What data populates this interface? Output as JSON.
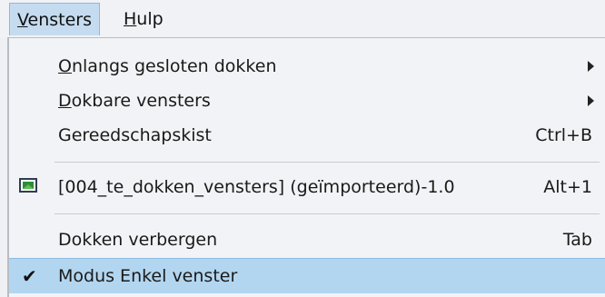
{
  "menubar": {
    "items": [
      {
        "accel": "V",
        "rest": "ensters"
      },
      {
        "accel": "H",
        "rest": "ulp"
      }
    ]
  },
  "menu": {
    "items": [
      {
        "accel": "O",
        "rest": "nlangs gesloten dokken",
        "submenu": true
      },
      {
        "accel": "D",
        "rest": "okbare vensters",
        "submenu": true
      },
      {
        "label": "Gereedschapskist",
        "shortcut": "Ctrl+B"
      },
      {
        "label": "[004_te_dokken_vensters] (geïmporteerd)-1.0",
        "shortcut": "Alt+1",
        "icon": "window-icon"
      },
      {
        "label": "Dokken verbergen",
        "shortcut": "Tab"
      },
      {
        "label": "Modus Enkel venster",
        "checked": true,
        "check_glyph": "✔"
      }
    ]
  },
  "colors": {
    "highlight": "#b3d6f0",
    "menubar_active": "#c5dcf0"
  }
}
